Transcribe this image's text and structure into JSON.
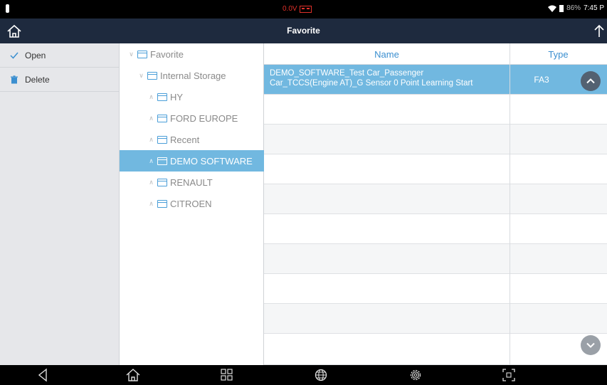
{
  "status": {
    "voltage": "0.0V",
    "battery_pct": "86%",
    "time": "7:45 P"
  },
  "titlebar": {
    "title": "Favorite"
  },
  "menu": {
    "open": "Open",
    "delete": "Delete"
  },
  "tree": [
    {
      "label": "Favorite",
      "expanded": true
    },
    {
      "label": "Internal Storage",
      "expanded": true
    },
    {
      "label": "HY",
      "expanded": false
    },
    {
      "label": "FORD EUROPE",
      "expanded": false
    },
    {
      "label": "Recent",
      "expanded": false
    },
    {
      "label": "DEMO SOFTWARE",
      "expanded": false,
      "selected": true
    },
    {
      "label": "RENAULT",
      "expanded": false
    },
    {
      "label": "CITROEN",
      "expanded": false
    }
  ],
  "table": {
    "headers": {
      "name": "Name",
      "type": "Type"
    },
    "rows": [
      {
        "name_line1": "DEMO_SOFTWARE_Test Car_Passenger",
        "name_line2": "Car_TCCS(Engine AT)_G Sensor 0 Point Learning Start",
        "type": "FA3"
      }
    ]
  },
  "colors": {
    "titlebar_bg": "#1e2a3e",
    "accent": "#3b8fd0",
    "selection": "#71b8e0",
    "menu_bg": "#e6e7ea"
  },
  "icons": {
    "home": "home-icon",
    "upload": "upload-icon",
    "open": "check-icon",
    "delete": "trash-icon",
    "nav_back": "back-triangle-icon",
    "nav_home": "home-outline-icon",
    "nav_apps": "grid-icon",
    "nav_globe": "globe-icon",
    "nav_settings": "gear-icon",
    "nav_screenshot": "screenshot-icon"
  }
}
